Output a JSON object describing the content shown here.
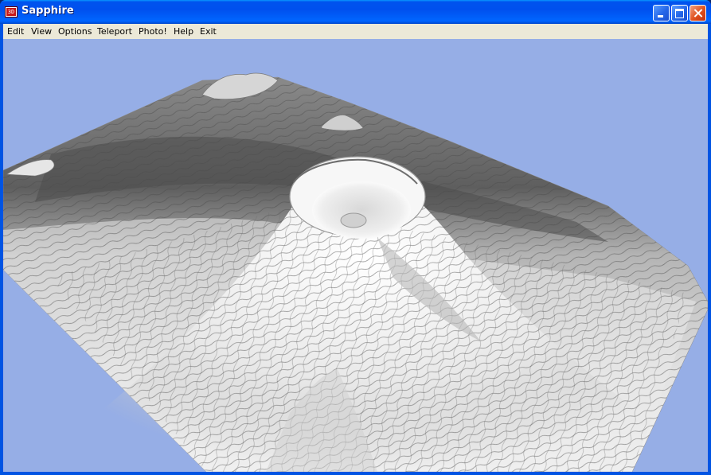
{
  "window": {
    "title": "Sapphire",
    "icon": "app-3d-icon",
    "icon_label": "3D",
    "controls": [
      "minimize-icon",
      "maximize-icon",
      "close-icon"
    ]
  },
  "menu": {
    "items": [
      {
        "label": "Edit"
      },
      {
        "label": "View"
      },
      {
        "label": "Options"
      },
      {
        "label": "Teleport"
      },
      {
        "label": "Photo!"
      },
      {
        "label": "Help"
      },
      {
        "label": "Exit"
      }
    ]
  },
  "viewport": {
    "scene": "3d-terrain-render",
    "sky_color": "#96aee6",
    "terrain_colors": [
      "#f4f4f4",
      "#b8b8b8",
      "#5a5a5a"
    ]
  },
  "colors": {
    "titlebar": "#0054e3",
    "menubar": "#ece9d8",
    "close_button": "#e0501c"
  }
}
